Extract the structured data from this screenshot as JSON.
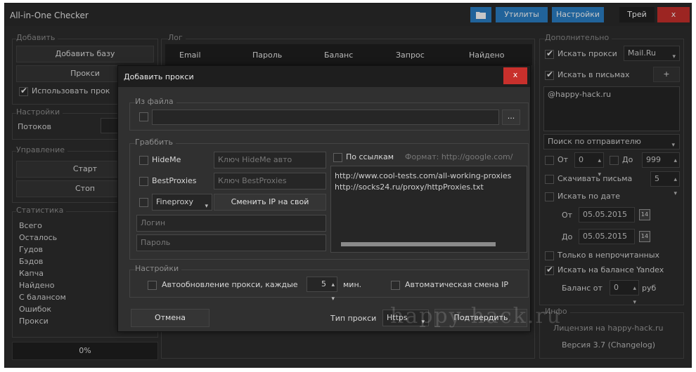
{
  "window": {
    "title": "All-in-One Checker",
    "buttons": {
      "utilities": "Утилиты",
      "settings": "Настройки",
      "tray": "Трей",
      "close": "x"
    }
  },
  "add": {
    "section_label": "Добавить",
    "add_base": "Добавить базу",
    "proxy": "Прокси",
    "use_proxy": "Использовать прок"
  },
  "settings_left": {
    "section_label": "Настройки",
    "threads_label": "Потоков"
  },
  "control": {
    "section_label": "Управление",
    "start": "Старт",
    "stop": "Стоп"
  },
  "stats": {
    "section_label": "Статистика",
    "items": [
      "Всего",
      "Осталось",
      "Гудов",
      "Бэдов",
      "Капча",
      "Найдено",
      "С балансом",
      "Ошибок",
      "Прокси"
    ],
    "progress": "0%"
  },
  "log": {
    "section_label": "Лог",
    "columns": [
      "Email",
      "Пароль",
      "Баланс",
      "Запрос",
      "Найдено"
    ]
  },
  "extra": {
    "section_label": "Дополнительно",
    "search_mail": "Искать прокси",
    "mail_select": "Mail.Ru",
    "search_in_letters": "Искать в письмах",
    "search_text": "@happy-hack.ru",
    "sender_select": "Поиск по отправителю",
    "from": "От",
    "from_value": "0",
    "to": "До",
    "to_value": "999",
    "download_letters": "Скачивать письма",
    "download_value": "5",
    "search_by_date": "Искать по дате",
    "date_from_label": "От",
    "date_from": "05.05.2015",
    "date_to_label": "До",
    "date_to": "05.05.2015",
    "unread_only": "Только в непрочитанных",
    "yandex_balance": "Искать на балансе Yandex",
    "balance_from_label": "Баланс от",
    "balance_value": "0",
    "currency": "руб"
  },
  "info": {
    "section_label": "Инфо",
    "license": "Лицензия на happy-hack.ru",
    "version": "Версия 3.7 (Changelog)"
  },
  "modal": {
    "title": "Добавить прокси",
    "close": "x",
    "from_file_label": "Из файла",
    "browse": "...",
    "grab_label": "Граббить",
    "hideme": "HideMe",
    "hideme_key_placeholder": "Ключ HideMe авто",
    "bestproxies": "BestProxies",
    "bestproxies_key_placeholder": "Ключ BestProxies",
    "proxy_type_select": "Fineproxy",
    "change_ip": "Сменить IP на свой",
    "login_placeholder": "Логин",
    "password_placeholder": "Пароль",
    "by_links": "По ссылкам",
    "format_hint": "Формат: http://google.com/",
    "links": [
      "http://www.cool-tests.com/all-working-proxies",
      "http://socks24.ru/proxy/httpProxies.txt"
    ],
    "settings_label": "Настройки",
    "auto_update": "Автообновление прокси, каждые",
    "auto_update_value": "5",
    "minutes": "мин.",
    "auto_change_ip": "Автоматическая смена IP",
    "cancel": "Отмена",
    "proxy_type_label": "Тип прокси",
    "proxy_type_value": "Https",
    "confirm": "Подтвердить"
  },
  "watermark": "happy-hack.ru"
}
